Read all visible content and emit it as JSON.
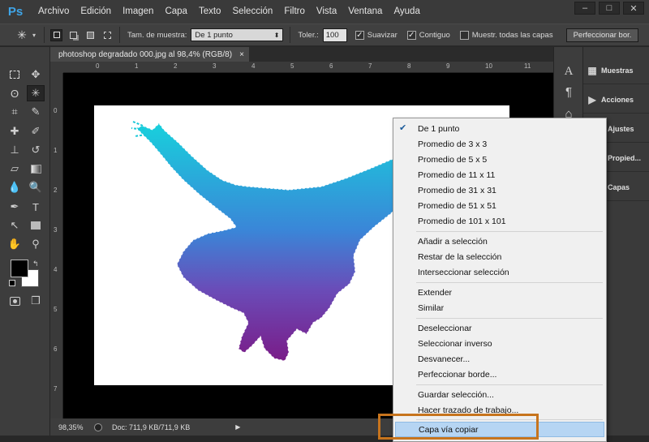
{
  "app": {
    "logo": "Ps",
    "document_title": "photoshop degradado 000.jpg al 98,4% (RGB/8)",
    "close_tab": "×"
  },
  "menu": [
    "Archivo",
    "Edición",
    "Imagen",
    "Capa",
    "Texto",
    "Selección",
    "Filtro",
    "Vista",
    "Ventana",
    "Ayuda"
  ],
  "window_controls": {
    "minimize": "–",
    "maximize": "□",
    "close": "✕"
  },
  "options": {
    "sample_label": "Tam. de muestra:",
    "sample_value": "De 1 punto",
    "tolerance_label": "Toler.:",
    "tolerance_value": "100",
    "antialias_label": "Suavizar",
    "contiguous_label": "Contiguo",
    "sample_all_label": "Muestr. todas las capas",
    "refine_button": "Perfeccionar bor."
  },
  "rulers": {
    "h": [
      "0",
      "1",
      "2",
      "3",
      "4",
      "5",
      "6",
      "7",
      "8",
      "9",
      "10",
      "11"
    ],
    "v": [
      "0",
      "1",
      "2",
      "3",
      "4",
      "5",
      "6",
      "7"
    ]
  },
  "status": {
    "zoom": "98,35%",
    "doc": "Doc: 711,9 KB/711,9 KB"
  },
  "panels": [
    {
      "label": "Muestras",
      "icon": "grid-icon"
    },
    {
      "label": "Acciones",
      "icon": "play-icon"
    },
    {
      "label": "Ajustes",
      "icon": "adjust-icon"
    },
    {
      "label": "Propied...",
      "icon": "properties-icon"
    },
    {
      "label": "Capas",
      "icon": "layers-icon"
    }
  ],
  "context_menu": {
    "group1": [
      "De 1 punto",
      "Promedio de 3 x 3",
      "Promedio de 5 x 5",
      "Promedio de 11 x 11",
      "Promedio de 31 x 31",
      "Promedio de 51 x 51",
      "Promedio de 101 x 101"
    ],
    "group2": [
      "Añadir a selección",
      "Restar de la selección",
      "Interseccionar selección"
    ],
    "group3": [
      "Extender",
      "Similar"
    ],
    "group4": [
      "Deseleccionar",
      "Seleccionar inverso",
      "Desvanecer...",
      "Perfeccionar borde..."
    ],
    "group5": [
      "Guardar selección...",
      "Hacer trazado de trabajo...",
      "Capa vía copiar"
    ],
    "checked": "De 1 punto",
    "highlighted": "Capa vía copiar"
  },
  "colors": {
    "accent": "#c7741d",
    "gradient_top": "#18c8d8",
    "gradient_mid": "#4a6fd0",
    "gradient_bottom": "#7a1f8c"
  }
}
